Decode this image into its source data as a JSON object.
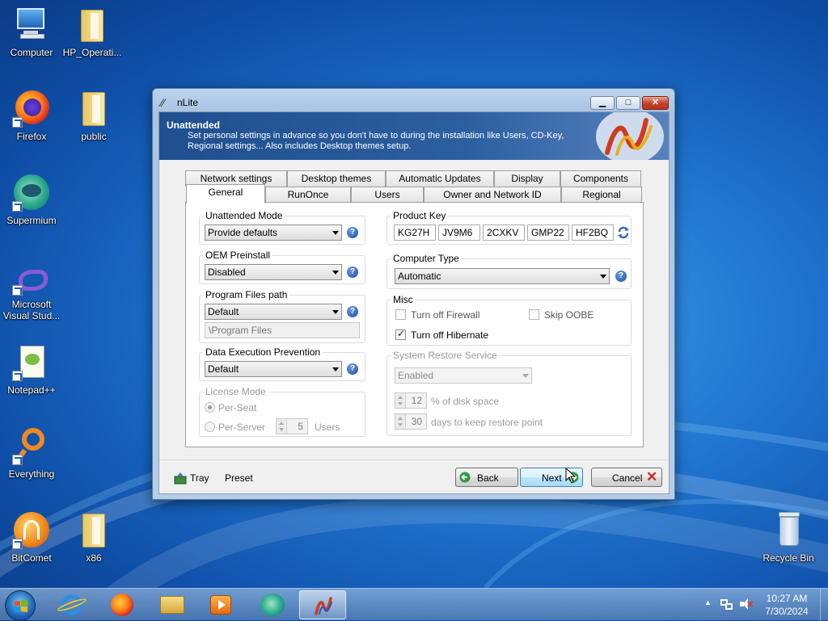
{
  "desktop": {
    "icons": [
      {
        "label": "Computer"
      },
      {
        "label": "HP_Operati..."
      },
      {
        "label": "Firefox"
      },
      {
        "label": "public"
      },
      {
        "label": "Supermium"
      },
      {
        "label": "Microsoft Visual Stud..."
      },
      {
        "label": "Notepad++"
      },
      {
        "label": "Everything"
      },
      {
        "label": "BitComet"
      },
      {
        "label": "x86"
      },
      {
        "label": "Recycle Bin"
      }
    ]
  },
  "window": {
    "title": "nLite",
    "banner": {
      "title": "Unattended",
      "description": "Set personal settings in advance so you don't have to during the installation like Users, CD-Key, Regional settings... Also includes Desktop themes setup."
    },
    "tabs_back": [
      "Network settings",
      "Desktop themes",
      "Automatic Updates",
      "Display",
      "Components"
    ],
    "tabs_front": [
      "General",
      "RunOnce",
      "Users",
      "Owner and Network ID",
      "Regional"
    ],
    "active_tab": "General",
    "general": {
      "unattended_mode": {
        "label": "Unattended Mode",
        "value": "Provide defaults"
      },
      "oem_preinstall": {
        "label": "OEM Preinstall",
        "value": "Disabled"
      },
      "program_files": {
        "label": "Program Files path",
        "value": "Default",
        "path": "\\Program Files"
      },
      "dep": {
        "label": "Data Execution Prevention",
        "value": "Default"
      },
      "license_mode": {
        "label": "License Mode",
        "per_seat": "Per-Seat",
        "per_server": "Per-Server",
        "users_count": "5",
        "users_label": "Users"
      },
      "product_key": {
        "label": "Product Key",
        "parts": [
          "KG27H",
          "JV9M6",
          "2CXKV",
          "GMP22",
          "HF2BQ"
        ]
      },
      "computer_type": {
        "label": "Computer Type",
        "value": "Automatic"
      },
      "misc": {
        "label": "Misc",
        "turn_off_firewall": {
          "label": "Turn off Firewall",
          "checked": false
        },
        "skip_oobe": {
          "label": "Skip OOBE",
          "checked": false
        },
        "turn_off_hibernate": {
          "label": "Turn off Hibernate",
          "checked": true
        }
      },
      "system_restore": {
        "label": "System Restore Service",
        "value": "Enabled",
        "disk_space": "12",
        "disk_space_label": "% of disk space",
        "days": "30",
        "days_label": "days to keep restore point"
      }
    },
    "footer": {
      "tray": "Tray",
      "preset": "Preset",
      "back": "Back",
      "next": "Next",
      "cancel": "Cancel"
    }
  },
  "taskbar": {
    "time": "10:27 AM",
    "date": "7/30/2024"
  },
  "colors": {
    "accent": "#1f4f8f",
    "help_icon": "#1c4fa5",
    "close_button": "#c7442b"
  }
}
